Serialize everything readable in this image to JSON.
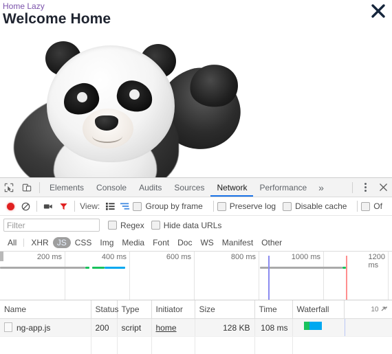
{
  "page": {
    "breadcrumb_link": "Home Lazy",
    "title": "Welcome Home",
    "close_icon": "close-icon",
    "image_alt": "panda"
  },
  "devtools": {
    "tabs": [
      {
        "label": "Elements",
        "active": false
      },
      {
        "label": "Console",
        "active": false
      },
      {
        "label": "Audits",
        "active": false
      },
      {
        "label": "Sources",
        "active": false
      },
      {
        "label": "Network",
        "active": true
      },
      {
        "label": "Performance",
        "active": false
      }
    ],
    "more_tabs_label": "»",
    "toolbar": {
      "view_label": "View:",
      "checkboxes": [
        {
          "label": "Group by frame",
          "checked": false
        },
        {
          "label": "Preserve log",
          "checked": false
        },
        {
          "label": "Disable cache",
          "checked": false
        },
        {
          "label": "Of",
          "checked": false
        }
      ]
    },
    "filterbar": {
      "placeholder": "Filter",
      "value": "",
      "regex_label": "Regex",
      "hide_data_urls_label": "Hide data URLs"
    },
    "types": [
      {
        "label": "All",
        "active": false
      },
      {
        "label": "XHR",
        "active": false
      },
      {
        "label": "JS",
        "active": true
      },
      {
        "label": "CSS",
        "active": false
      },
      {
        "label": "Img",
        "active": false
      },
      {
        "label": "Media",
        "active": false
      },
      {
        "label": "Font",
        "active": false
      },
      {
        "label": "Doc",
        "active": false
      },
      {
        "label": "WS",
        "active": false
      },
      {
        "label": "Manifest",
        "active": false
      },
      {
        "label": "Other",
        "active": false
      }
    ],
    "overview": {
      "ticks": [
        "200 ms",
        "400 ms",
        "600 ms",
        "800 ms",
        "1000 ms",
        "1200 ms"
      ],
      "dom_content_loaded_color": "#8a8aef",
      "load_color": "#ff8f8f",
      "bar_colors": {
        "waiting": "#aaaaaa",
        "green": "#19c25d",
        "blue": "#00a8f0"
      }
    },
    "table": {
      "columns": [
        "Name",
        "Status",
        "Type",
        "Initiator",
        "Size",
        "Time",
        "Waterfall"
      ],
      "sort_indicator": "10",
      "rows": [
        {
          "name": "ng-app.js",
          "status": "200",
          "type": "script",
          "initiator": "home",
          "size": "128 KB",
          "time": "108 ms"
        }
      ]
    }
  },
  "colors": {
    "accent": "#1a73e8",
    "link": "#7b52ab",
    "record_red": "#e02020",
    "filter_red": "#e02020"
  }
}
